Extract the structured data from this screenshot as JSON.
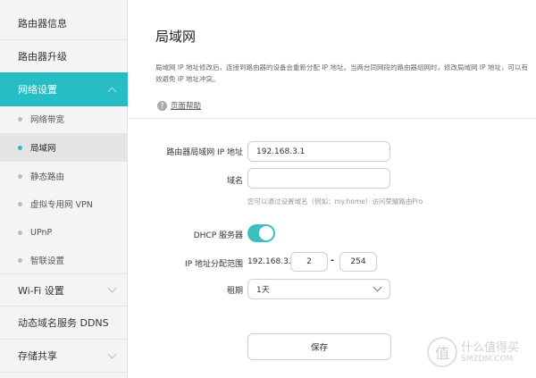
{
  "sidebar": {
    "items_top": [
      "路由器信息",
      "路由器升级"
    ],
    "network": "网络设置",
    "sub": [
      "网络带宽",
      "局域网",
      "静态路由",
      "虚拟专用网 VPN",
      "UPnP",
      "智联设置"
    ],
    "items_bottom": [
      "Wi-Fi 设置",
      "动态域名服务 DDNS",
      "存储共享"
    ]
  },
  "main": {
    "title": "局域网",
    "desc": "局域网 IP 地址修改后，连接到路由器的设备会重新分配 IP 地址。当两台同网段的路由器组网时，修改局域网 IP 地址，可以有效避免 IP 地址冲突。",
    "help": "页面帮助",
    "help_icon": "?",
    "ip_label": "路由器局域网 IP 地址",
    "ip_value": "192.168.3.1",
    "domain_label": "域名",
    "domain_value": "",
    "domain_hint": "您可以通过设置域名（例如：my.home）访问荣耀路由Pro",
    "dhcp_label": "DHCP 服务器",
    "dhcp_on": true,
    "range_label": "IP 地址分配范围",
    "range_prefix": "192.168.3.",
    "range_start": "2",
    "range_sep": "-",
    "range_end": "254",
    "lease_label": "租期",
    "lease_value": "1天",
    "save": "保存"
  },
  "watermark": {
    "icon": "值",
    "line1": "什么值得买",
    "line2": "SMZDM.COM"
  },
  "colors": {
    "accent": "#26bec4"
  }
}
